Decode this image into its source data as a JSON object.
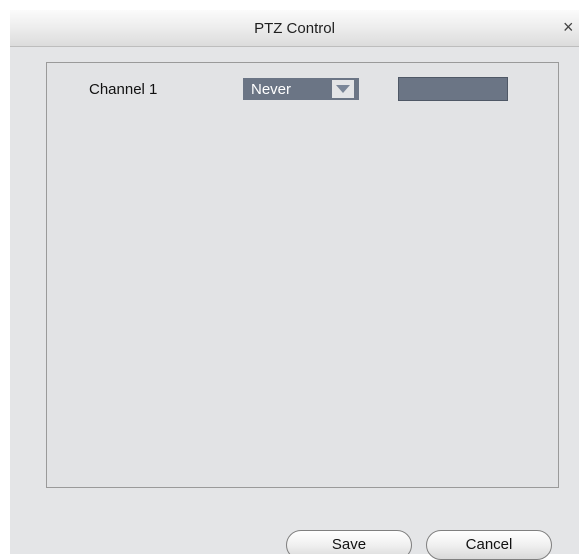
{
  "dialog": {
    "title": "PTZ Control",
    "close_glyph": "×"
  },
  "channel": {
    "label": "Channel 1",
    "mode": {
      "selected": "Never",
      "arrow_icon": "dropdown-arrow-icon"
    },
    "time_value": ""
  },
  "buttons": {
    "save": "Save",
    "cancel": "Cancel"
  },
  "colors": {
    "select_bg": "#6b7585",
    "dialog_bg": "#e4e5e7"
  }
}
